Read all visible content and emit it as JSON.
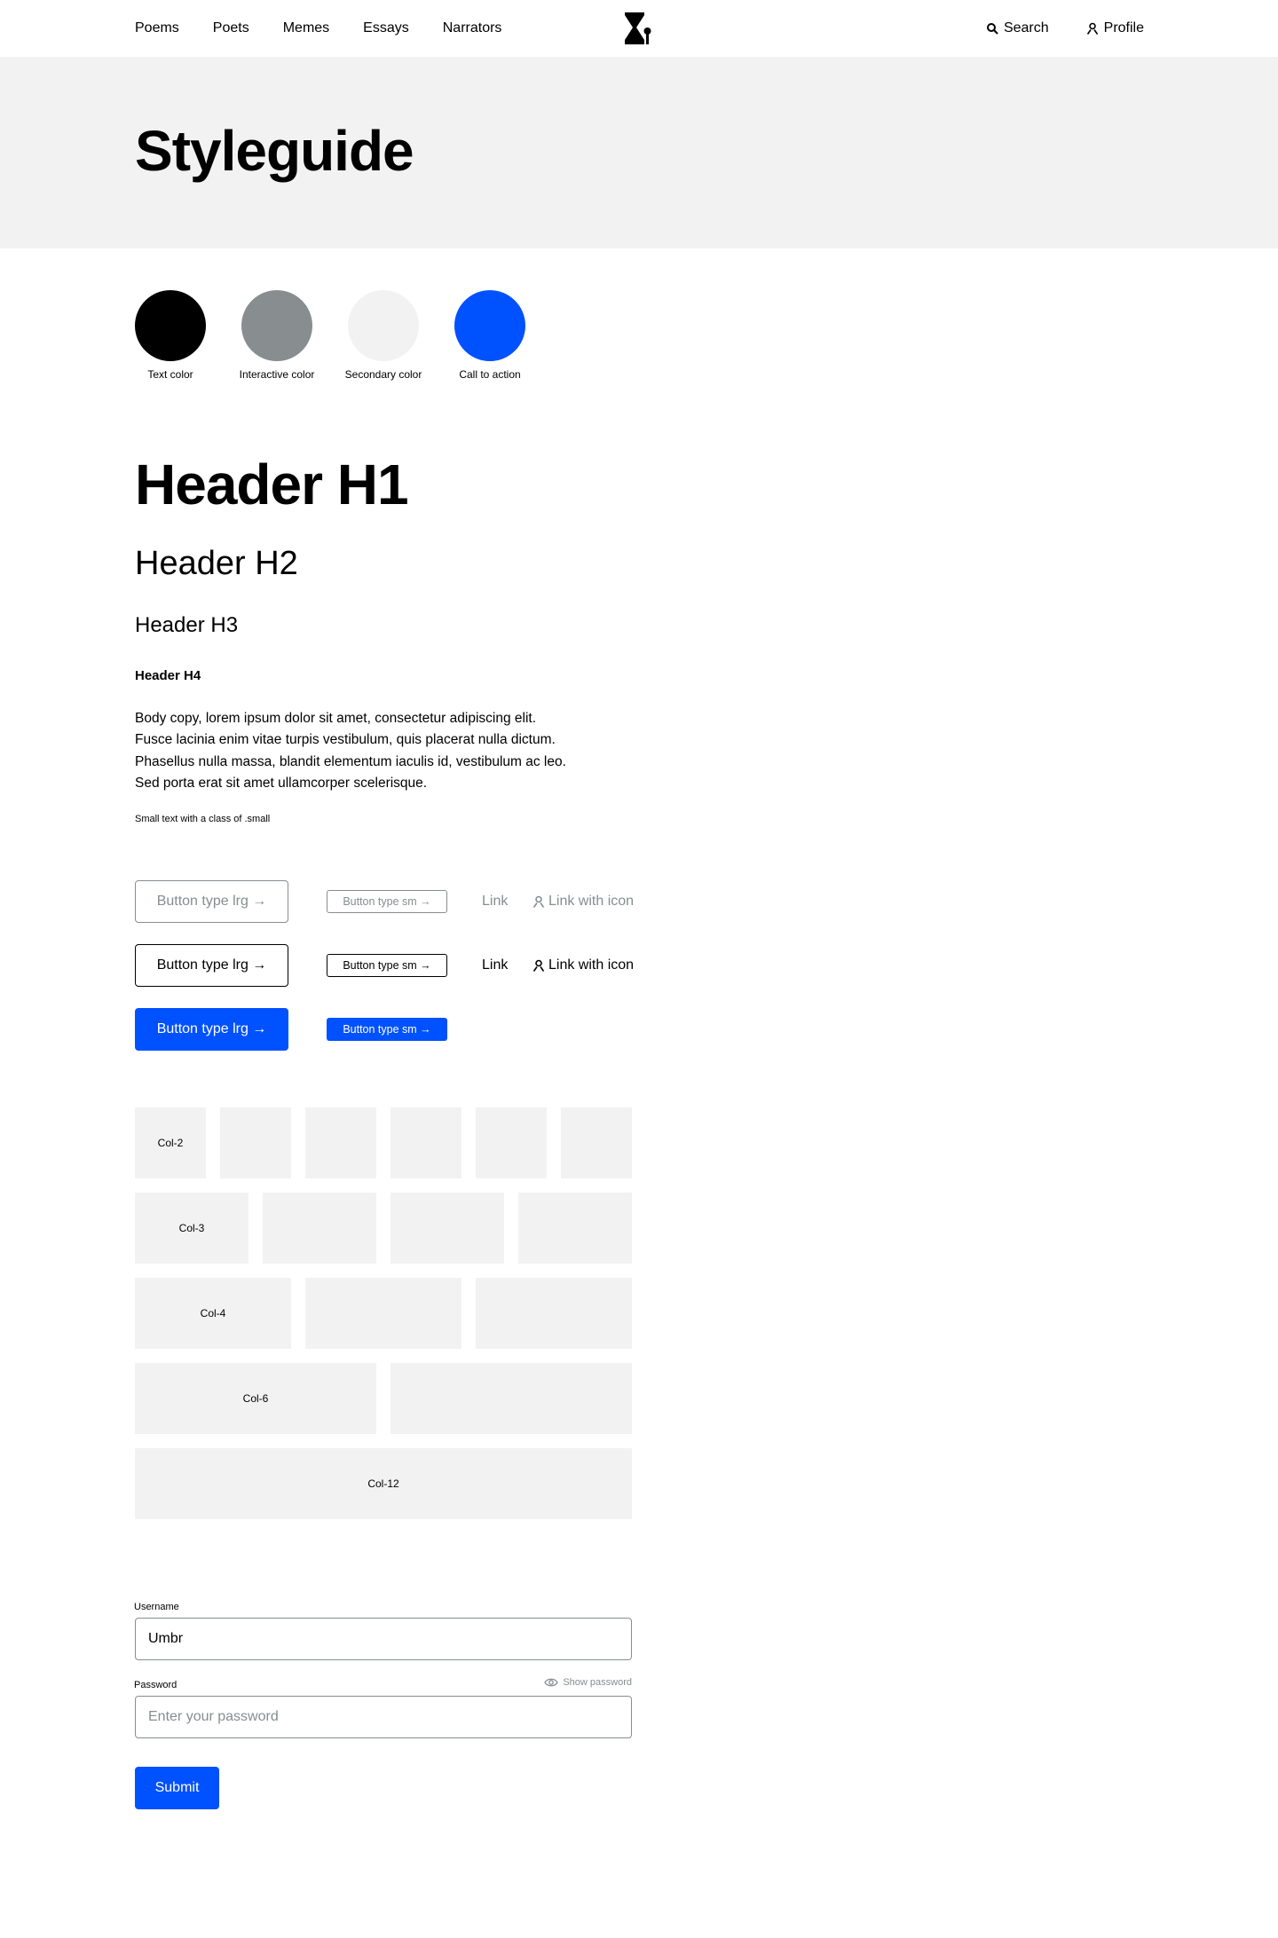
{
  "nav": {
    "links": [
      "Poems",
      "Poets",
      "Memes",
      "Essays",
      "Narrators"
    ],
    "search_label": "Search",
    "profile_label": "Profile"
  },
  "hero": {
    "title": "Styleguide"
  },
  "swatches": [
    {
      "label": "Text color",
      "color": "#000000"
    },
    {
      "label": "Interactive color",
      "color": "#888d90"
    },
    {
      "label": "Secondary color",
      "color": "#f2f2f2"
    },
    {
      "label": "Call to action",
      "color": "#0051ff"
    }
  ],
  "typography": {
    "h1": "Header H1",
    "h2": "Header H2",
    "h3": "Header H3",
    "h4": "Header H4",
    "body_lines": [
      "Body copy, lorem ipsum dolor sit amet, consectetur adipiscing elit.",
      "Fusce lacinia enim vitae turpis vestibulum, quis placerat nulla dictum.",
      "Phasellus nulla massa, blandit elementum iaculis id, vestibulum ac leo.",
      "Sed porta erat sit amet ullamcorper scelerisque."
    ],
    "small": "Small text with a class of .small"
  },
  "buttons": {
    "lrg_label": "Button type lrg →",
    "sm_label": "Button type sm →",
    "link_label": "Link",
    "link_icon_label": "Link with icon"
  },
  "grid": {
    "col2": "Col-2",
    "col3": "Col-3",
    "col4": "Col-4",
    "col6": "Col-6",
    "col12": "Col-12"
  },
  "form": {
    "username_label": "Username",
    "username_value": "Umbr",
    "password_label": "Password",
    "password_placeholder": "Enter your password",
    "show_password": "Show password",
    "submit_label": "Submit"
  },
  "colors": {
    "accent": "#0051ff",
    "muted": "#888d90",
    "surface": "#f2f2f2"
  }
}
